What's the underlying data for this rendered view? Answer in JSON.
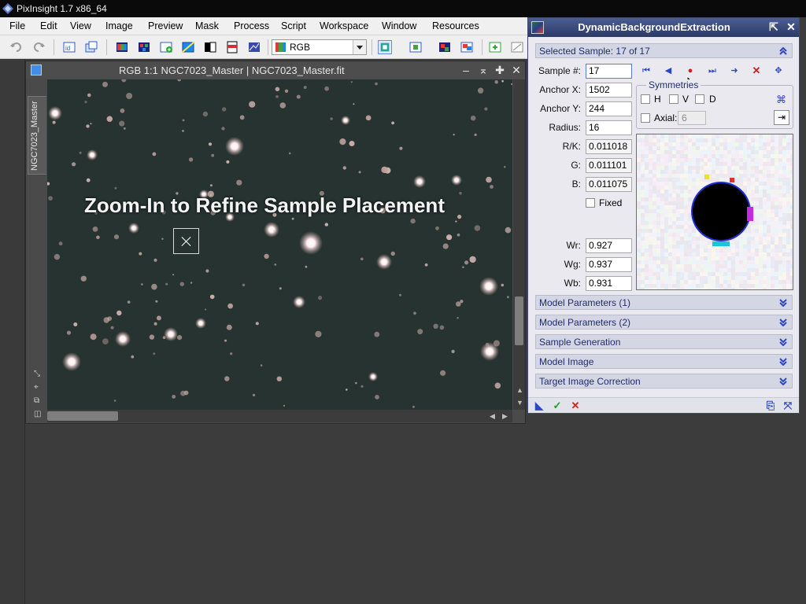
{
  "app": {
    "title": "PixInsight 1.7 x86_64"
  },
  "menu": {
    "items": [
      "File",
      "Edit",
      "View",
      "Image",
      "Preview",
      "Mask",
      "Process",
      "Script",
      "Workspace",
      "Window",
      "Resources"
    ]
  },
  "toolbar": {
    "channel_select": "RGB",
    "icons": [
      "undo-icon",
      "redo-icon",
      "identifier-icon",
      "clone-icon",
      "rgb-channels-icon",
      "channel-combine-icon",
      "new-image-icon",
      "split-icon",
      "mask-icon",
      "print-icon",
      "statistics-icon",
      "channel-select-icon",
      "preview-icon",
      "preview-new-icon",
      "preview-rect-icon",
      "new-window-icon",
      "settings-icon"
    ]
  },
  "image_window": {
    "title": "RGB 1:1 NGC7023_Master | NGC7023_Master.fit",
    "vertical_tab": "NGC7023_Master",
    "caption": "Zoom-In to Refine Sample Placement"
  },
  "dbe": {
    "title": "DynamicBackgroundExtraction",
    "selected_sample": "Selected Sample: 17 of 17",
    "fields": {
      "sample_label": "Sample #:",
      "sample_value": "17",
      "anchor_x_label": "Anchor X:",
      "anchor_x_value": "1502",
      "anchor_y_label": "Anchor Y:",
      "anchor_y_value": "244",
      "radius_label": "Radius:",
      "radius_value": "16",
      "rk_label": "R/K:",
      "rk_value": "0.011018",
      "g_label": "G:",
      "g_value": "0.011101",
      "b_label": "B:",
      "b_value": "0.011075",
      "fixed_label": "Fixed",
      "wr_label": "Wr:",
      "wr_value": "0.927",
      "wg_label": "Wg:",
      "wg_value": "0.937",
      "wb_label": "Wb:",
      "wb_value": "0.931"
    },
    "symmetries": {
      "title": "Symmetries",
      "h_label": "H",
      "v_label": "V",
      "d_label": "D",
      "axial_label": "Axial:",
      "axial_value": "6"
    },
    "sections": [
      "Model Parameters (1)",
      "Model Parameters (2)",
      "Sample Generation",
      "Model Image",
      "Target Image Correction"
    ]
  },
  "colors": {
    "panel_header": "#2c3a66",
    "section_text": "#1f2d6b",
    "accent_blue": "#2d46c4",
    "close_red": "#d02020",
    "apply_green": "#1f9a2a"
  }
}
